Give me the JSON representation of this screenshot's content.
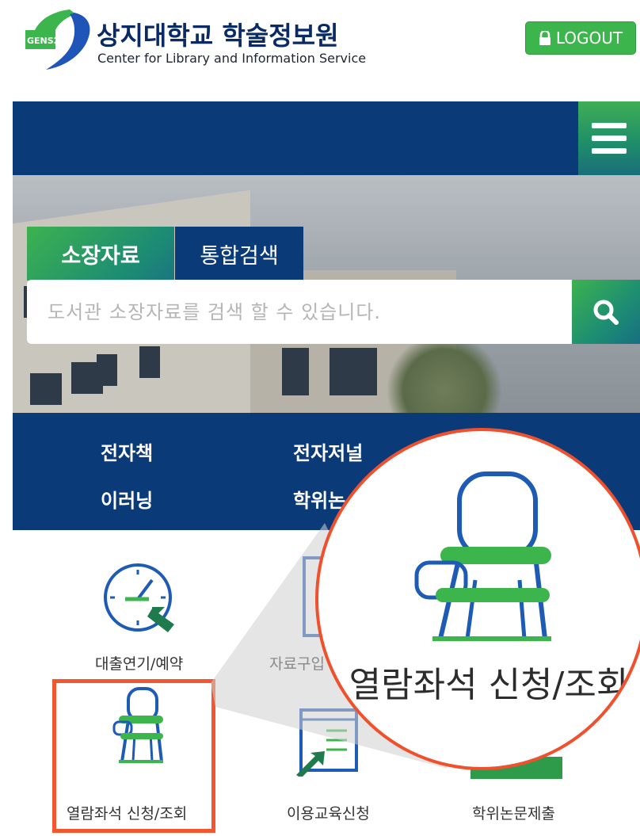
{
  "header": {
    "logo_icon": "gens21-logo-icon",
    "logo_badge": "GENS21",
    "title": "상지대학교 학술정보원",
    "subtitle": "Center for Library and Information Service",
    "logout_label": "LOGOUT",
    "logout_icon": "lock-icon"
  },
  "nav": {
    "menu_icon": "hamburger-menu-icon"
  },
  "search": {
    "tabs": [
      {
        "label": "소장자료",
        "active": true
      },
      {
        "label": "통합검색",
        "active": false
      }
    ],
    "placeholder": "도서관 소장자료를 검색 할 수 있습니다.",
    "button_icon": "search-icon"
  },
  "quick_links": [
    "전자책",
    "전자저널",
    "이러닝",
    "학위논"
  ],
  "services": [
    {
      "label": "대출연기/예약",
      "icon": "clock-icon"
    },
    {
      "label": "자료구입",
      "icon": "document-icon"
    },
    {
      "label": "열람좌석 신청/조회",
      "icon": "chair-icon"
    },
    {
      "label": "이용교육신청",
      "icon": "document-arrow-icon"
    },
    {
      "label": "학위논문제출",
      "icon": "thesis-icon"
    }
  ],
  "magnifier": {
    "label": "열람좌석 신청/조회",
    "icon": "chair-icon"
  },
  "colors": {
    "navy": "#0b3a78",
    "green": "#3cb64c",
    "highlight": "#f2572f"
  }
}
